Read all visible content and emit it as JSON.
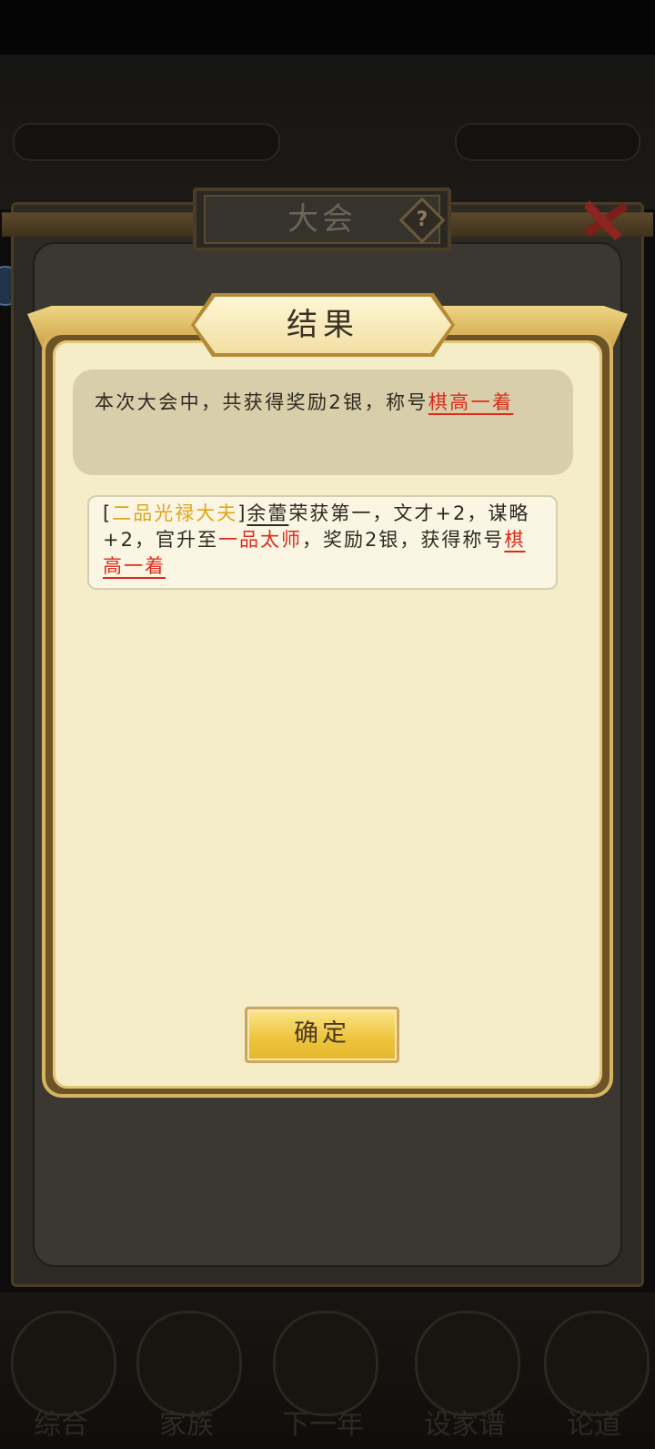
{
  "background": {
    "bottom_nav": [
      "综合",
      "家族",
      "下一年",
      "设家谱",
      "论道"
    ]
  },
  "outer_panel": {
    "title": "大会",
    "help_glyph": "?",
    "close_icon": "close-icon"
  },
  "result_dialog": {
    "title": "结果",
    "summary": {
      "text": "本次大会中，共获得奖励2银，称号",
      "title_award": "棋高一着"
    },
    "log": {
      "open_bracket": "[",
      "rank": "二品光禄大夫",
      "close_bracket": "]",
      "name": "余蕾",
      "text1": "荣获第一，文才+2，谋略+2，官升至",
      "new_rank": "一品太师",
      "text2": "，奖励2银，获得称号",
      "title_award": "棋高一着"
    },
    "confirm_label": "确定"
  },
  "colors": {
    "highlight_red": "#dd2a1b",
    "rank_gold": "#e0a51a",
    "dialog_bg": "#f5ecc8",
    "button_gold": "#eec53e"
  }
}
